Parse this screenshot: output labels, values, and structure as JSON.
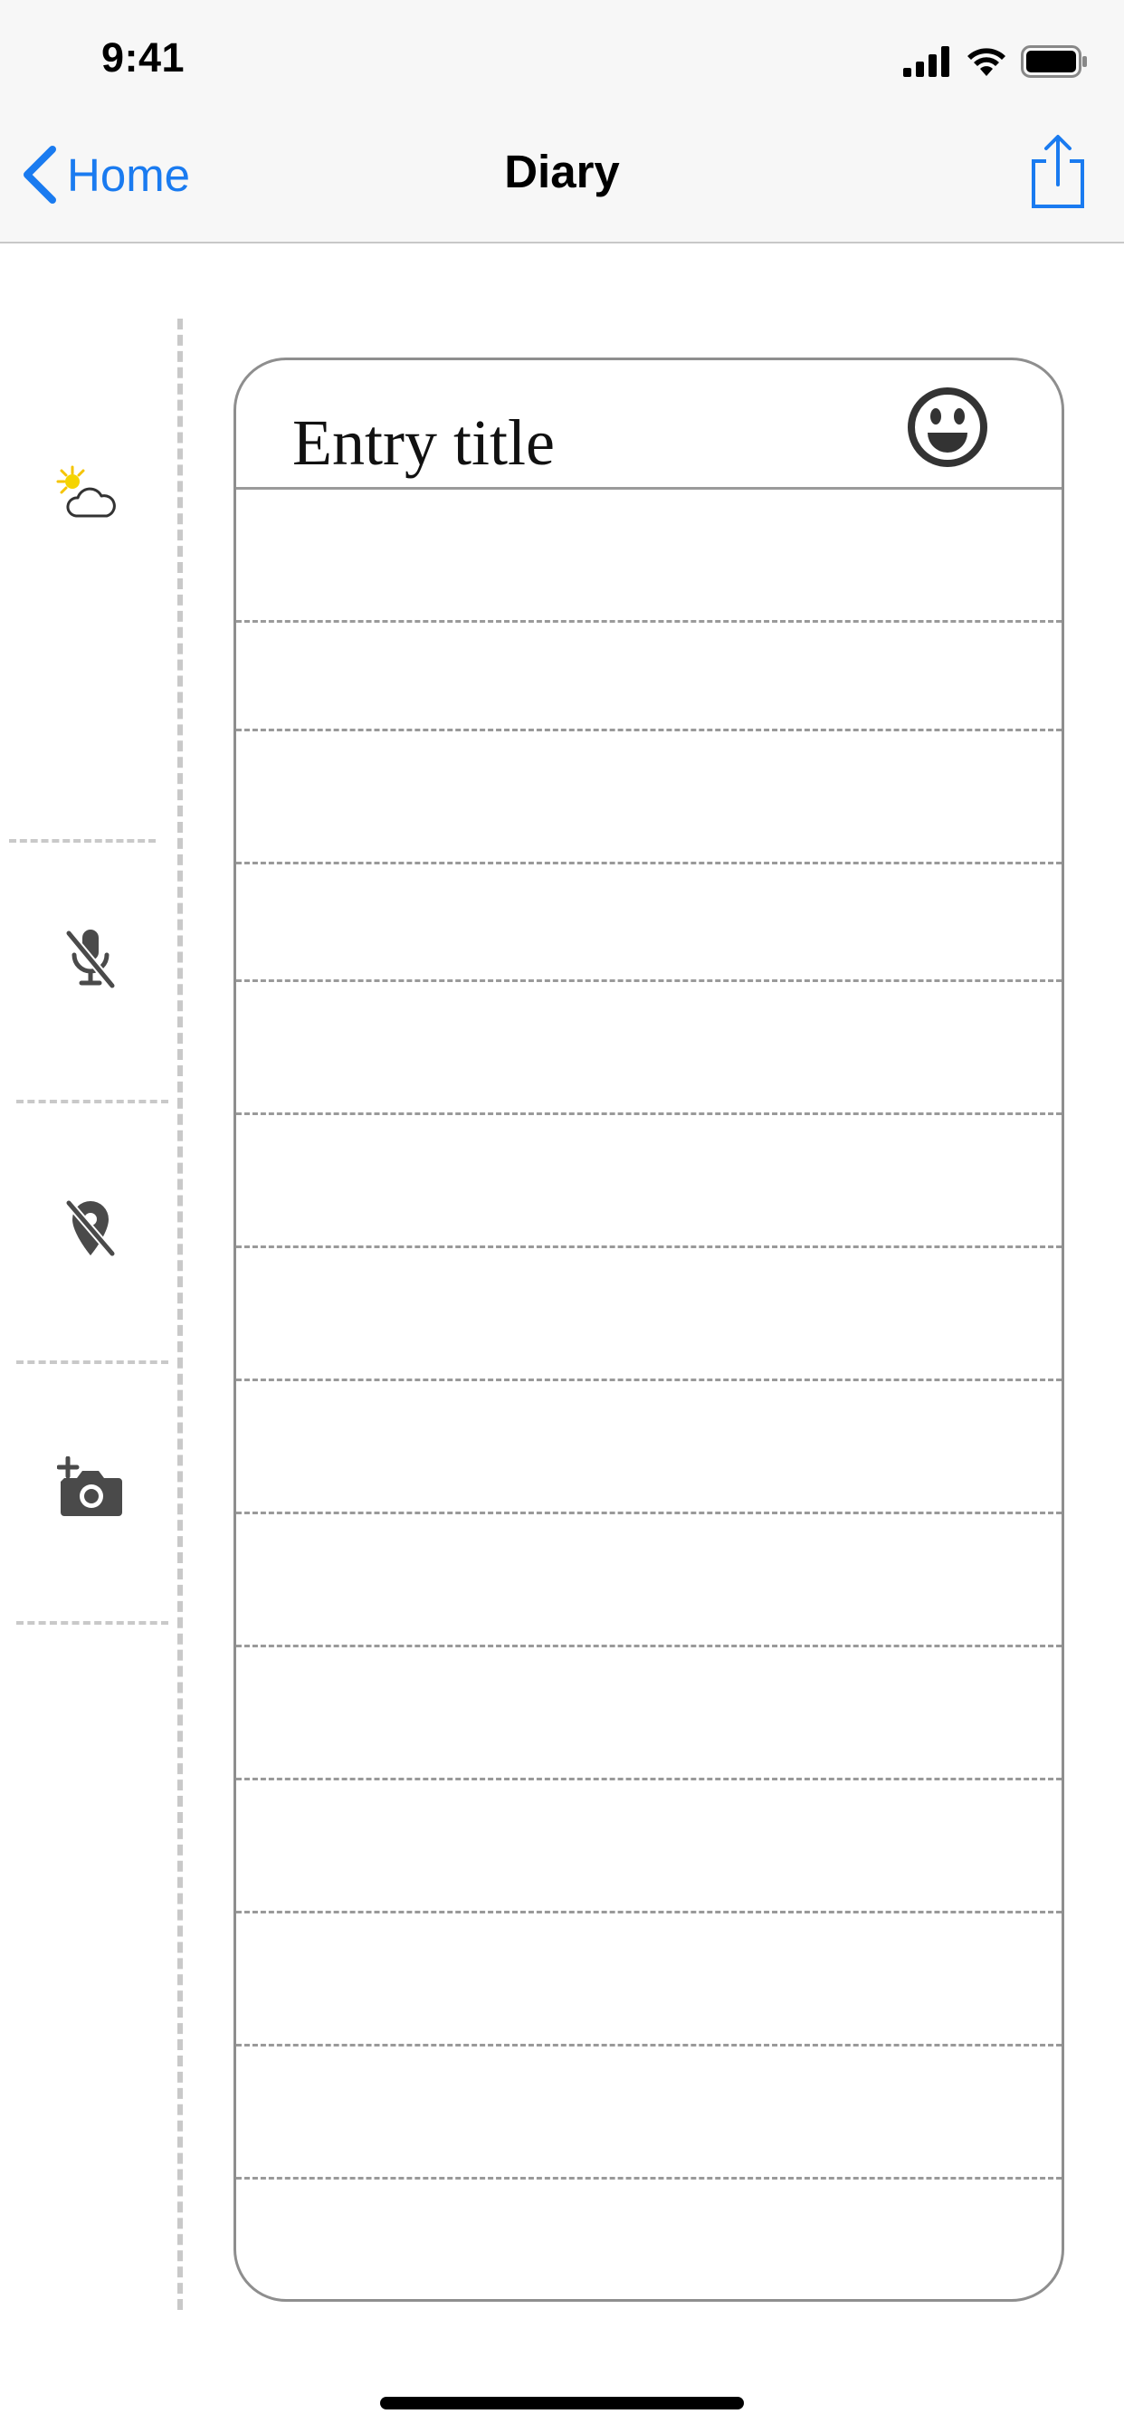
{
  "status_bar": {
    "time": "9:41",
    "icons": [
      "cellular-signal-icon",
      "wifi-icon",
      "battery-icon"
    ]
  },
  "nav": {
    "back_label": "Home",
    "title": "Diary",
    "share_icon": "share-icon"
  },
  "sidebar": {
    "items": [
      {
        "name": "weather",
        "icon": "partly-sunny-icon"
      },
      {
        "name": "audio",
        "icon": "microphone-off-icon"
      },
      {
        "name": "location",
        "icon": "location-off-icon"
      },
      {
        "name": "photo",
        "icon": "add-photo-icon"
      }
    ]
  },
  "entry": {
    "title_placeholder": "Entry title",
    "mood_icon": "smiley-icon",
    "line_count": 13
  },
  "colors": {
    "accent": "#1a7bf0",
    "nav_background": "#f7f7f7",
    "rule": "#9a9a9a",
    "divider": "#c9c9c9",
    "icon": "#4a4a4a"
  }
}
